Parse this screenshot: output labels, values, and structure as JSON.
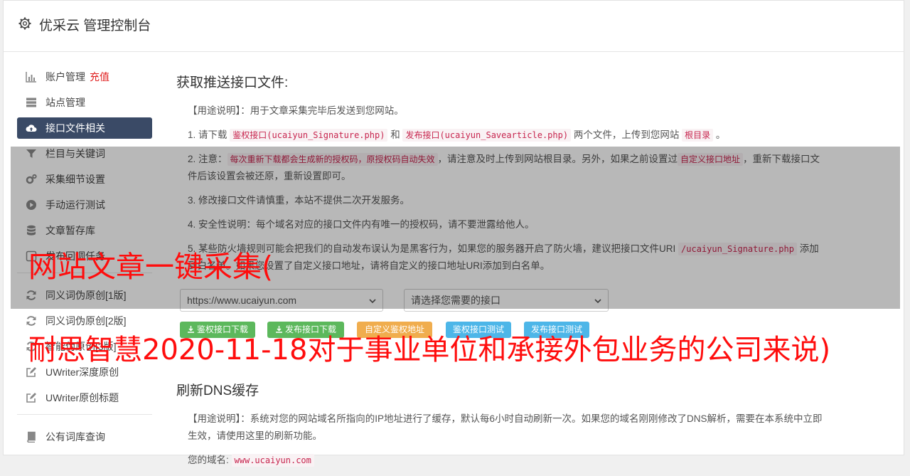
{
  "header": {
    "title": "优采云 管理控制台"
  },
  "sidebar": {
    "group1": [
      {
        "label": "账户管理",
        "extra": "充值",
        "icon": "bar-chart-icon"
      },
      {
        "label": "站点管理",
        "icon": "server-icon"
      },
      {
        "label": "接口文件相关",
        "icon": "cloud-upload-icon",
        "active": true
      },
      {
        "label": "栏目与关键词",
        "icon": "filter-icon"
      },
      {
        "label": "采集细节设置",
        "icon": "cogs-icon"
      },
      {
        "label": "手动运行测试",
        "icon": "play-icon"
      },
      {
        "label": "文章暂存库",
        "icon": "database-icon"
      },
      {
        "label": "发布回调任务",
        "icon": "checkbox-icon"
      }
    ],
    "group2": [
      {
        "label": "同义词伪原创[1版]",
        "icon": "refresh-icon"
      },
      {
        "label": "同义词伪原创[2版]",
        "icon": "refresh-icon"
      },
      {
        "label": "智能伪原创[3版]",
        "icon": "refresh-icon"
      },
      {
        "label": "UWriter深度原创",
        "icon": "edit-icon"
      },
      {
        "label": "UWriter原创标题",
        "icon": "edit-icon"
      }
    ],
    "group3": [
      {
        "label": "公有词库查询",
        "icon": "book-icon"
      }
    ]
  },
  "push": {
    "title": "获取推送接口文件:",
    "usage_prefix": "【用途说明】：",
    "usage": "用于文章采集完毕后发送到您网站。",
    "p1_a": "1. 请下载 ",
    "p1_code1": "鉴权接口(ucaiyun_Signature.php)",
    "p1_b": " 和 ",
    "p1_code2": "发布接口(ucaiyun_Savearticle.php)",
    "p1_c": " 两个文件，上传到您网站 ",
    "p1_code3": "根目录",
    "p1_d": " 。",
    "p2_a": "2. 注意：",
    "p2_code1": "每次重新下载都会生成新的授权码，原授权码自动失效",
    "p2_b": "，请注意及时上传到网站根目录。另外，如果之前设置过",
    "p2_code2": "自定义接口地址",
    "p2_c": "，重新下载接口文件后该设置会被还原，重新设置即可。",
    "p3": "3. 修改接口文件请慎重，本站不提供二次开发服务。",
    "p4": "4. 安全性说明：每个域名对应的接口文件内有唯一的授权码，请不要泄露给他人。",
    "p5_a": "5. 某些防火墙规则可能会把我们的自动发布误认为是黑客行为，如果您的服务器开启了防火墙，建议把接口文件URI ",
    "p5_code": "/ucaiyun_Signature.php",
    "p5_b": " 添加到白名单。如果您设置了自定义接口地址，请将自定义的接口地址URI添加到白名单。",
    "site_select": "https://www.ucaiyun.com",
    "api_select": "请选择您需要的接口",
    "buttons": {
      "auth_dl": "鉴权接口下载",
      "pub_dl": "发布接口下载",
      "custom_auth": "自定义鉴权地址",
      "auth_test": "鉴权接口测试",
      "pub_test": "发布接口测试"
    }
  },
  "dns": {
    "title": "刷新DNS缓存",
    "usage_prefix": "【用途说明】：",
    "usage": "系统对您的网站域名所指向的IP地址进行了缓存，默认每6小时自动刷新一次。如果您的域名刚刚修改了DNS解析，需要在本系统中立即生效，请使用这里的刷新功能。",
    "domain_label": "您的域名: ",
    "domain_value": "www.ucaiyun.com"
  },
  "watermark": {
    "line1": "网站文章一键采集(",
    "line2": "耐思智慧2020-11-18对于事业单位和承接外包业务的公司来说)"
  },
  "colors": {
    "active_nav": "#3a4a66",
    "watermark": "#ff0d0d",
    "code": "#c7254e"
  }
}
